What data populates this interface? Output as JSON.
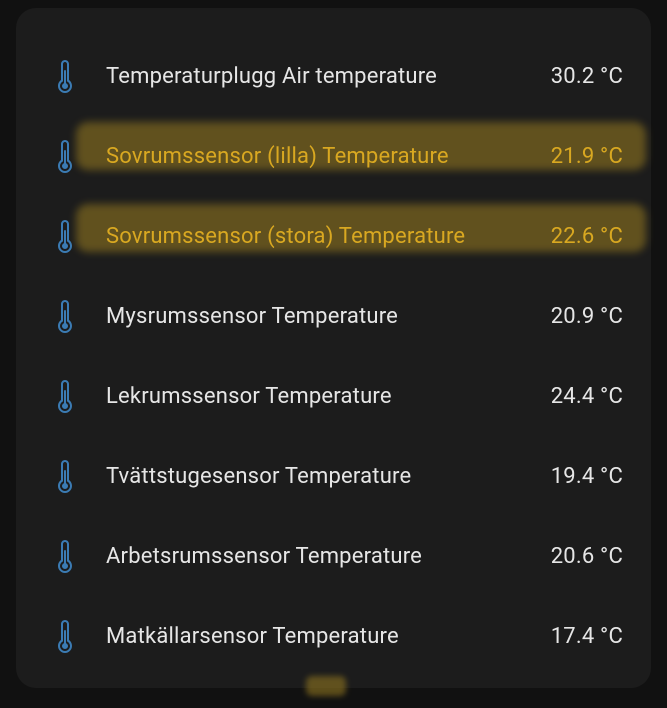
{
  "sensors": [
    {
      "name": "Temperaturplugg Air temperature",
      "value": "30.2 °C",
      "highlighted": false
    },
    {
      "name": "Sovrumssensor (lilla) Temperature",
      "value": "21.9 °C",
      "highlighted": true
    },
    {
      "name": "Sovrumssensor (stora) Temperature",
      "value": "22.6 °C",
      "highlighted": true
    },
    {
      "name": "Mysrumssensor Temperature",
      "value": "20.9 °C",
      "highlighted": false
    },
    {
      "name": "Lekrumssensor Temperature",
      "value": "24.4 °C",
      "highlighted": false
    },
    {
      "name": "Tvättstugesensor Temperature",
      "value": "19.4 °C",
      "highlighted": false
    },
    {
      "name": "Arbetsrumssensor Temperature",
      "value": "20.6 °C",
      "highlighted": false
    },
    {
      "name": "Matkällarsensor Temperature",
      "value": "17.4 °C",
      "highlighted": false
    }
  ],
  "colors": {
    "icon": "#3b7bb3",
    "text_normal": "#e6e6e6",
    "text_highlight": "#d9a821"
  }
}
